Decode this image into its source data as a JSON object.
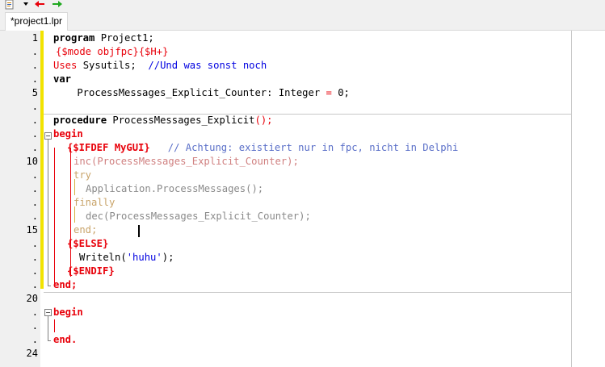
{
  "toolbar": {
    "icons": [
      "source-file-icon",
      "dropdown-arrow-icon",
      "back-arrow-icon",
      "forward-arrow-icon"
    ],
    "colors": {
      "back": "#e8000a",
      "forward": "#1fa81f"
    }
  },
  "tab": {
    "label": "*project1.lpr"
  },
  "line_numbers": [
    {
      "text": "1"
    },
    {
      "text": "."
    },
    {
      "text": "."
    },
    {
      "text": "."
    },
    {
      "text": "5"
    },
    {
      "text": "."
    },
    {
      "text": "."
    },
    {
      "text": "."
    },
    {
      "text": "."
    },
    {
      "text": "10"
    },
    {
      "text": "."
    },
    {
      "text": "."
    },
    {
      "text": "."
    },
    {
      "text": "."
    },
    {
      "text": "15"
    },
    {
      "text": "."
    },
    {
      "text": "."
    },
    {
      "text": "."
    },
    {
      "text": "."
    },
    {
      "text": "20"
    },
    {
      "text": "."
    },
    {
      "text": "."
    },
    {
      "text": "."
    },
    {
      "text": "24"
    }
  ],
  "code": {
    "l1": {
      "kw": "program",
      "rest": " Project1;"
    },
    "l2": {
      "dir": "{$mode objfpc}{$H+}"
    },
    "l3": {
      "kw": "Uses",
      "rest": " Sysutils;  ",
      "cm": "//Und was sonst noch"
    },
    "l4": {
      "kw": "var"
    },
    "l5": {
      "rest": "    ProcessMessages_Explicit_Counter: Integer ",
      "op": "=",
      "rest2": " 0;"
    },
    "l7": {
      "kw": "procedure",
      "rest": " ProcessMessages_Explicit",
      "op": "();"
    },
    "l8": {
      "kw": "begin"
    },
    "l9": {
      "dir": "{$IFDEF MyGUI}",
      "cm": "   // Achtung: existiert nur in fpc, nicht in Delphi"
    },
    "l10": {
      "dim": "inc(ProcessMessages_Explicit_Counter);"
    },
    "l11": {
      "dimkw": "try"
    },
    "l12": {
      "dim": "Application.ProcessMessages();"
    },
    "l13": {
      "dimkw": "finally"
    },
    "l14": {
      "dim": "dec(ProcessMessages_Explicit_Counter);"
    },
    "l15": {
      "dimkw": "end;"
    },
    "l16": {
      "dir": "{$ELSE}"
    },
    "l17": {
      "rest": "Writeln(",
      "str": "'huhu'",
      "rest2": ");"
    },
    "l18": {
      "dir": "{$ENDIF}"
    },
    "l19": {
      "kw": "end;"
    },
    "l21": {
      "kw": "begin"
    },
    "l23": {
      "kw": "end."
    }
  }
}
